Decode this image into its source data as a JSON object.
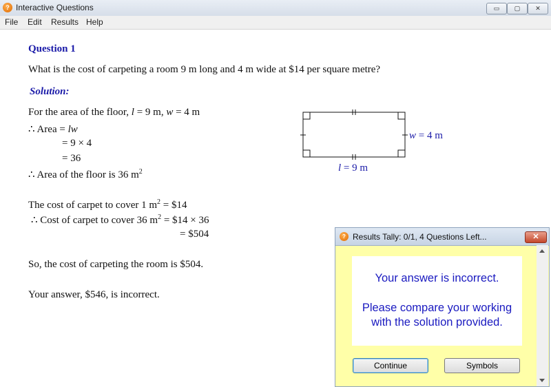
{
  "window": {
    "title": "Interactive Questions",
    "buttons": {
      "minimize": "▭",
      "maximize": "▢",
      "close": "✕"
    }
  },
  "menu": [
    "File",
    "Edit",
    "Results",
    "Help"
  ],
  "question": {
    "title": "Question 1",
    "text": "What is the cost of carpeting a room 9 m long and 4 m wide at $14 per square metre?"
  },
  "solution": {
    "title": "Solution:",
    "floor_intro_prefix": "For the area of the floor,",
    "l_var": "l",
    "l_eq": "= 9 m,",
    "w_var": "w",
    "w_eq": "= 4 m",
    "area_prefix": "∴ Area =",
    "area_formula": "lw",
    "step1": "= 9 × 4",
    "step2": "= 36",
    "area_result": "∴ Area of the floor is 36 m",
    "cost_line1": "The cost of carpet to cover 1 m",
    "cost_line1_tail": "= $14",
    "cost_line2": "∴ Cost of carpet to cover 36 m",
    "cost_line2_tail": "= $14 × 36",
    "cost_line3": "= $504",
    "conclusion": "So, the cost of carpeting the room is $504.",
    "answer_feedback": "Your answer, $546, is incorrect.",
    "sup2": "2"
  },
  "diagram": {
    "width_var": "w",
    "width_eq": "= 4 m",
    "length_var": "l",
    "length_eq": "= 9 m"
  },
  "dialog": {
    "title": "Results Tally: 0/1, 4 Questions Left...",
    "close": "✕",
    "message1": "Your answer is incorrect.",
    "message2": "Please compare your working with the solution provided.",
    "continue_label": "Continue",
    "symbols_label": "Symbols"
  },
  "app_icon": "?"
}
